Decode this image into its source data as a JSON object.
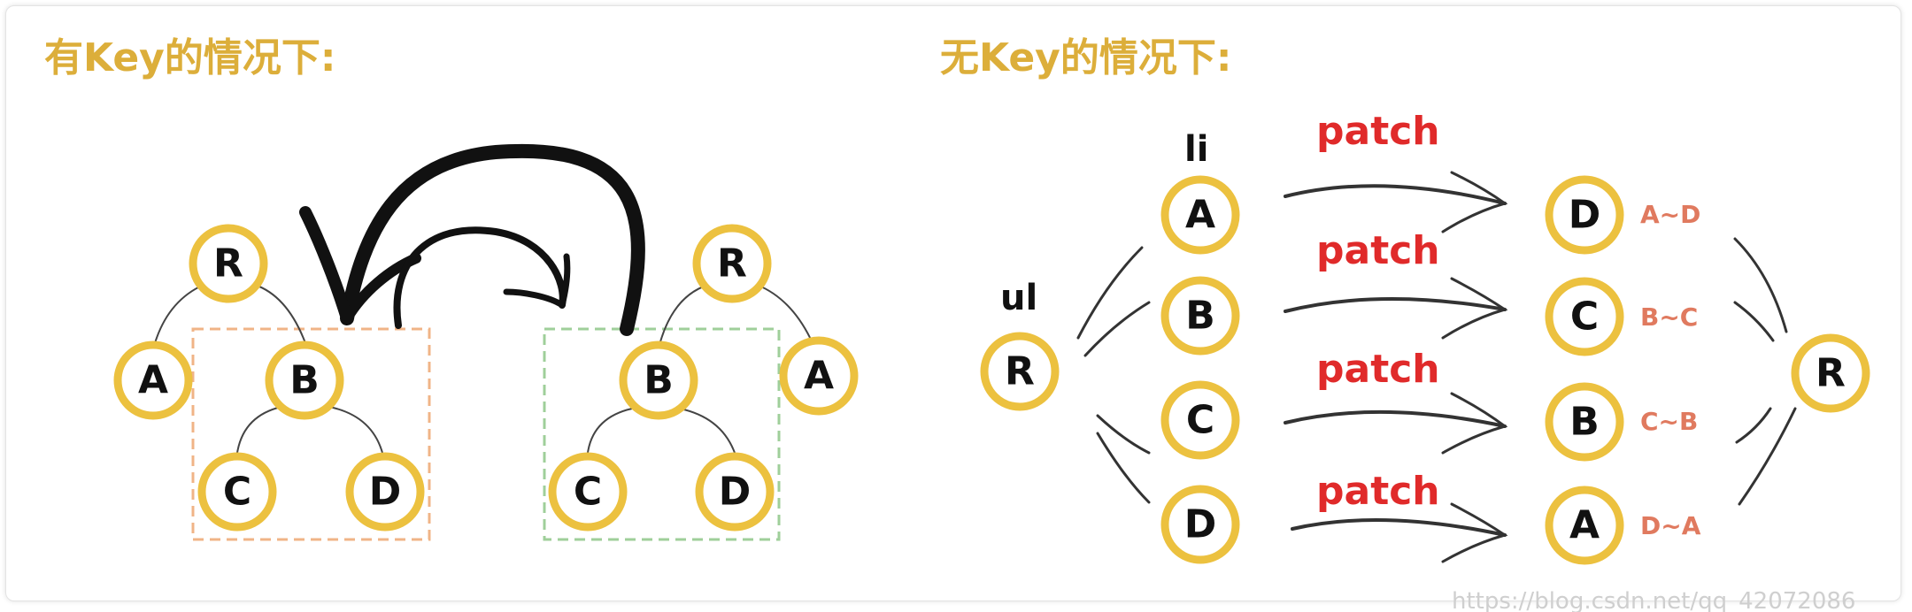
{
  "left_panel": {
    "title": "有Key的情况下:",
    "tree_a": {
      "root": "R",
      "left": "A",
      "mid": "B",
      "child1": "C",
      "child2": "D"
    },
    "tree_b": {
      "root": "R",
      "mid": "B",
      "right": "A",
      "child1": "C",
      "child2": "D"
    },
    "colors": {
      "orange_box": "#f0b487",
      "green_box": "#9fcf9a",
      "node_border": "#ecc13f",
      "title": "#dcae3a"
    }
  },
  "right_panel": {
    "title": "无Key的情况下:",
    "ul_label": "ul",
    "li_label": "li",
    "source_root": "R",
    "target_root": "R",
    "rows": [
      {
        "from": "A",
        "patch": "patch",
        "to": "D",
        "pair": "A~D"
      },
      {
        "from": "B",
        "patch": "patch",
        "to": "C",
        "pair": "B~C"
      },
      {
        "from": "C",
        "patch": "patch",
        "to": "B",
        "pair": "C~B"
      },
      {
        "from": "D",
        "patch": "patch",
        "to": "A",
        "pair": "D~A"
      }
    ],
    "colors": {
      "patch": "#e02a2a",
      "pair": "#e07a5f"
    }
  },
  "watermark": "https://blog.csdn.net/qq_42072086"
}
